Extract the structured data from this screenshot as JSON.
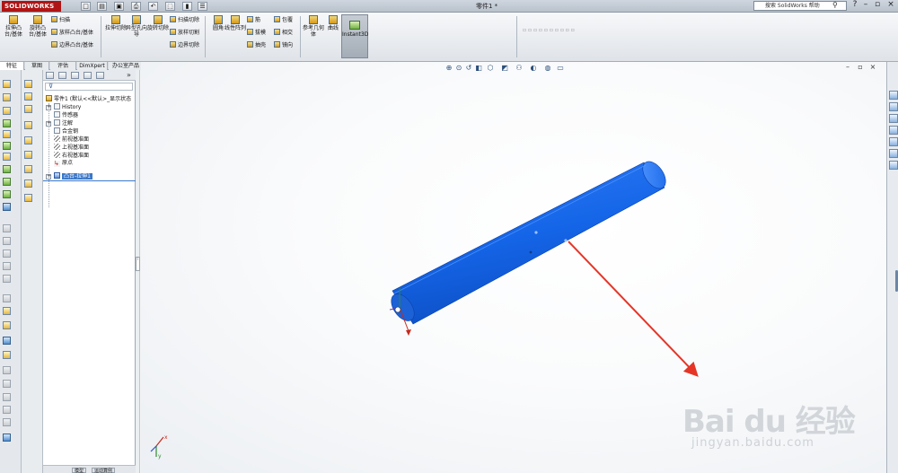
{
  "app": {
    "logo_text": "SOLIDWORKS",
    "document_title": "零件1 *",
    "search_placeholder": "搜索 SolidWorks 帮助"
  },
  "ribbon": {
    "boss_extrude": "拉伸凸台/基体",
    "revolve_boss": "旋转凸台/基体",
    "sweep": "扫描",
    "loft_boss": "放样凸台/基体",
    "boundary_boss": "边界凸台/基体",
    "cut_extrude": "拉伸切除",
    "hole_wizard": "异型孔向导",
    "revolve_cut": "旋转切除",
    "swept_cut": "扫描切除",
    "lofted_cut": "放样切割",
    "boundary_cut": "边界切除",
    "fillet": "圆角",
    "linear_pattern": "线性阵列",
    "rib": "筋",
    "draft": "拔模",
    "shell": "抽壳",
    "wrap": "包覆",
    "intersect": "相交",
    "mirror": "镜向",
    "ref_geometry": "参考几何体",
    "curves": "曲线",
    "instant3d": "Instant3D"
  },
  "tabs": [
    "特征",
    "草图",
    "评估",
    "DimXpert",
    "办公室产品"
  ],
  "active_tab": 0,
  "tree": {
    "root": "零件1 (默认<<默认>_显示状态",
    "items": [
      "History",
      "传感器",
      "注解",
      "合金钢",
      "前视基准面",
      "上视基准面",
      "右视基准面",
      "原点",
      "凸台-拉伸1"
    ],
    "selected": "凸台-拉伸1"
  },
  "bottom_tabs": [
    "模型",
    "运动算例"
  ],
  "watermark": {
    "brand": "Bai du 经验",
    "url": "jingyan.baidu.com"
  },
  "colors": {
    "model_blue": "#1565e8",
    "annotation_arrow": "#e53527",
    "selection": "#3c78c8"
  }
}
